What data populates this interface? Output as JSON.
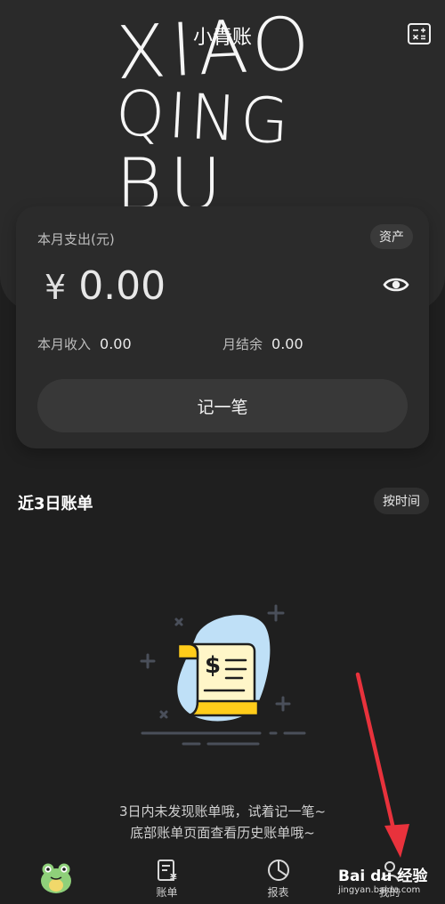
{
  "header": {
    "title": "小青账",
    "art_lines": [
      "XIAO",
      "QING",
      "BU"
    ],
    "calculator_icon": "calculator-icon"
  },
  "summary_card": {
    "expense_label": "本月支出(元)",
    "assets_label": "资产",
    "currency_symbol": "¥",
    "expense_amount": "0.00",
    "visibility_icon": "eye-icon",
    "income_label": "本月收入",
    "income_value": "0.00",
    "balance_label": "月结余",
    "balance_value": "0.00",
    "record_button": "记一笔"
  },
  "recent": {
    "title": "近3日账单",
    "sort_label": "按时间",
    "empty_line1": "3日内未发现账单哦，试着记一笔~",
    "empty_line2": "底部账单页面查看历史账单哦~",
    "illustration_icon": "receipt-icon"
  },
  "tabbar": {
    "tabs": [
      {
        "label": "",
        "icon": "frog-avatar-icon"
      },
      {
        "label": "账单",
        "icon": "bill-icon"
      },
      {
        "label": "报表",
        "icon": "pie-chart-icon"
      },
      {
        "label": "我的",
        "icon": "user-icon"
      }
    ]
  },
  "watermark": {
    "brand": "Bai du 经验",
    "url": "jingyan.baidu.com"
  },
  "colors": {
    "background": "#1f1f1f",
    "card": "#2b2b2b",
    "accent_yellow": "#ffcc1a",
    "annotation_red": "#e8323c",
    "illustration_blue": "#bfe0f7"
  }
}
